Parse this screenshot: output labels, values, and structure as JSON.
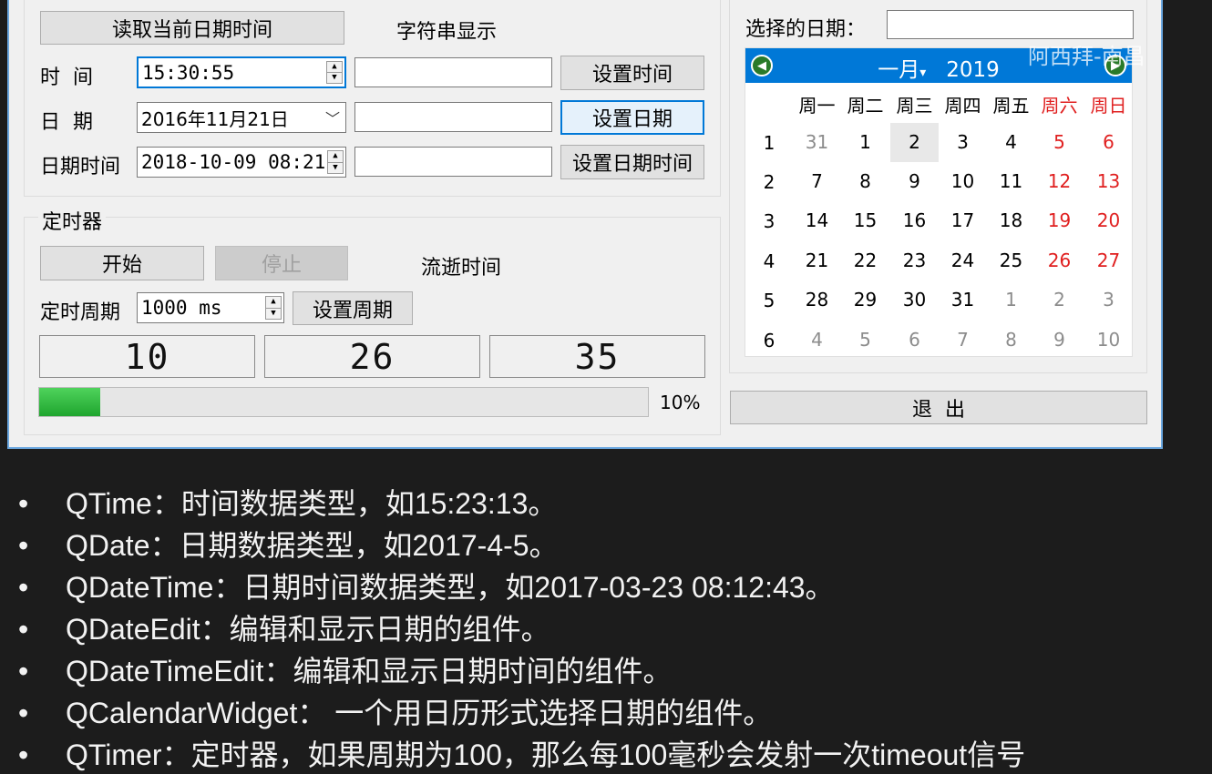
{
  "colors": {
    "accent": "#0078d7",
    "weekend": "#e02020",
    "progress": "#2db83d",
    "slide_bg": "#1c1c1c"
  },
  "datetime_panel": {
    "read_button": "读取当前日期时间",
    "string_display_label": "字符串显示",
    "time_label": "时  间",
    "time_value": "15:30:55",
    "set_time_button": "设置时间",
    "date_label": "日  期",
    "date_value": "2016年11月21日",
    "set_date_button": "设置日期",
    "datetime_label": "日期时间",
    "datetime_value": "2018-10-09 08:21",
    "set_datetime_button": "设置日期时间"
  },
  "timer_panel": {
    "title": "定时器",
    "start_button": "开始",
    "stop_button": "停止",
    "elapsed_label": "流逝时间",
    "period_label": "定时周期",
    "period_value": "1000 ms",
    "set_period_button": "设置周期",
    "lcd": [
      "10",
      "26",
      "35"
    ],
    "progress_percent": 10,
    "progress_text": "10%"
  },
  "calendar_panel": {
    "selected_date_label": "选择的日期：",
    "selected_date_value": "",
    "month": "一月",
    "year": "2019",
    "weekdays": [
      "周一",
      "周二",
      "周三",
      "周四",
      "周五",
      "周六",
      "周日"
    ],
    "week_numbers": [
      "1",
      "2",
      "3",
      "4",
      "5",
      "6"
    ],
    "days": [
      [
        "31",
        "1",
        "2",
        "3",
        "4",
        "5",
        "6"
      ],
      [
        "7",
        "8",
        "9",
        "10",
        "11",
        "12",
        "13"
      ],
      [
        "14",
        "15",
        "16",
        "17",
        "18",
        "19",
        "20"
      ],
      [
        "21",
        "22",
        "23",
        "24",
        "25",
        "26",
        "27"
      ],
      [
        "28",
        "29",
        "30",
        "31",
        "1",
        "2",
        "3"
      ],
      [
        "4",
        "5",
        "6",
        "7",
        "8",
        "9",
        "10"
      ]
    ],
    "selected_day": "2",
    "exit_button": "退  出"
  },
  "watermark": "阿西拜-南昌",
  "bullets": [
    "QTime：时间数据类型，如15:23:13。",
    "QDate：日期数据类型，如2017-4-5。",
    "QDateTime：日期时间数据类型，如2017-03-23 08:12:43。",
    "QDateEdit：编辑和显示日期的组件。",
    "QDateTimeEdit：编辑和显示日期时间的组件。",
    "QCalendarWidget： 一个用日历形式选择日期的组件。",
    "QTimer：定时器，如果周期为100，那么每100毫秒会发射一次timeout信号"
  ]
}
